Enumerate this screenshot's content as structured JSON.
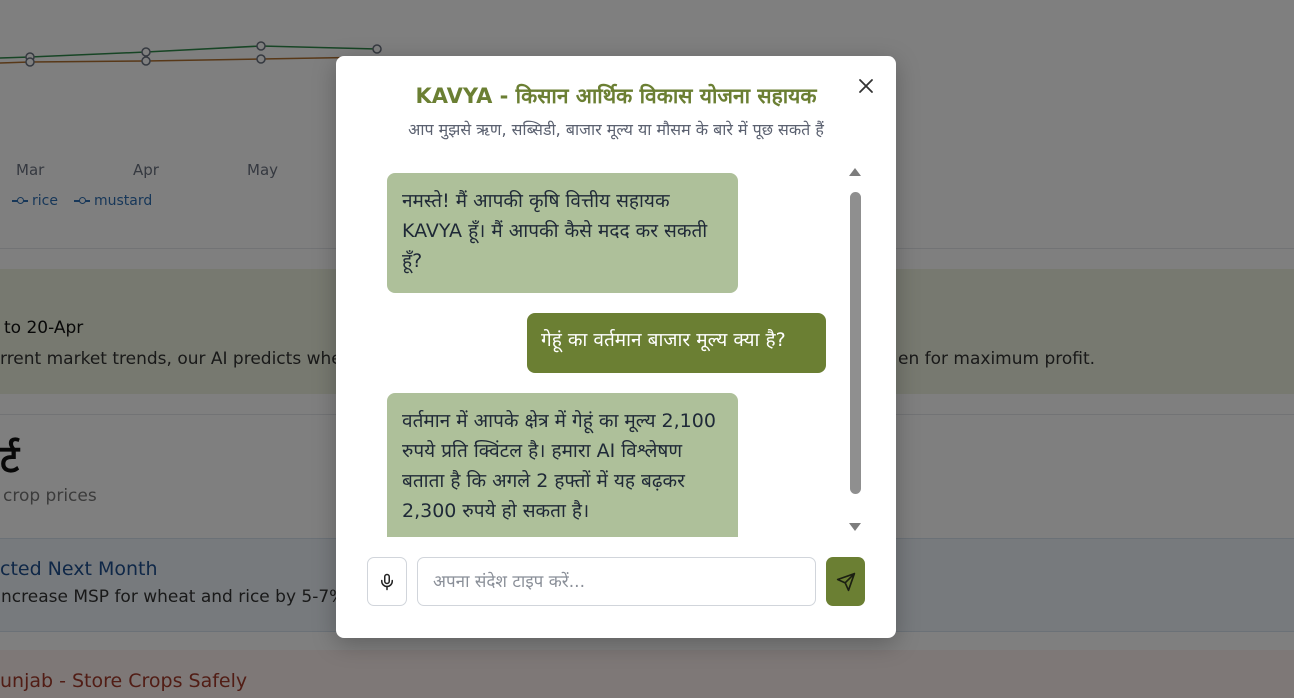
{
  "background": {
    "chart": {
      "months": [
        "Mar",
        "Apr",
        "May"
      ],
      "legend": [
        "rice",
        "mustard"
      ],
      "line_colors": {
        "green": "#2f8a4a",
        "orange": "#b07030",
        "gray": "#6b7280"
      }
    },
    "recommendation": {
      "date_text": "to 20-Apr",
      "body_start": "rrent market trends, our AI predicts whea",
      "body_end": "en for maximum profit."
    },
    "report": {
      "heading_fragment": "र्ट",
      "subheading": "crop prices"
    },
    "alerts": [
      {
        "title": "cted Next Month",
        "body": "ncrease MSP for wheat and rice by 5-7%"
      },
      {
        "title": "unjab - Store Crops Safely"
      }
    ]
  },
  "modal": {
    "title": "KAVYA - किसान आर्थिक विकास योजना सहायक",
    "subtitle": "आप मुझसे ऋण, सब्सिडी, बाजार मूल्य या मौसम के बारे में पूछ सकते हैं",
    "accent_color": "#6b7f33",
    "bot_bubble_color": "#aec09a",
    "messages": [
      {
        "sender": "bot",
        "text": "नमस्ते! मैं आपकी कृषि वित्तीय सहायक KAVYA हूँ। मैं आपकी कैसे मदद कर सकती हूँ?"
      },
      {
        "sender": "user",
        "text": "गेहूं का वर्तमान बाजार मूल्य क्या है?"
      },
      {
        "sender": "bot",
        "text": "वर्तमान में आपके क्षेत्र में गेहूं का मूल्य 2,100 रुपये प्रति क्विंटल है। हमारा AI विश्लेषण बताता है कि अगले 2 हफ्तों में यह बढ़कर 2,300 रुपये हो सकता है।"
      }
    ],
    "input": {
      "placeholder": "अपना संदेश टाइप करें...",
      "value": ""
    },
    "icons": {
      "close": "close-icon",
      "mic": "microphone-icon",
      "send": "send-icon"
    }
  }
}
